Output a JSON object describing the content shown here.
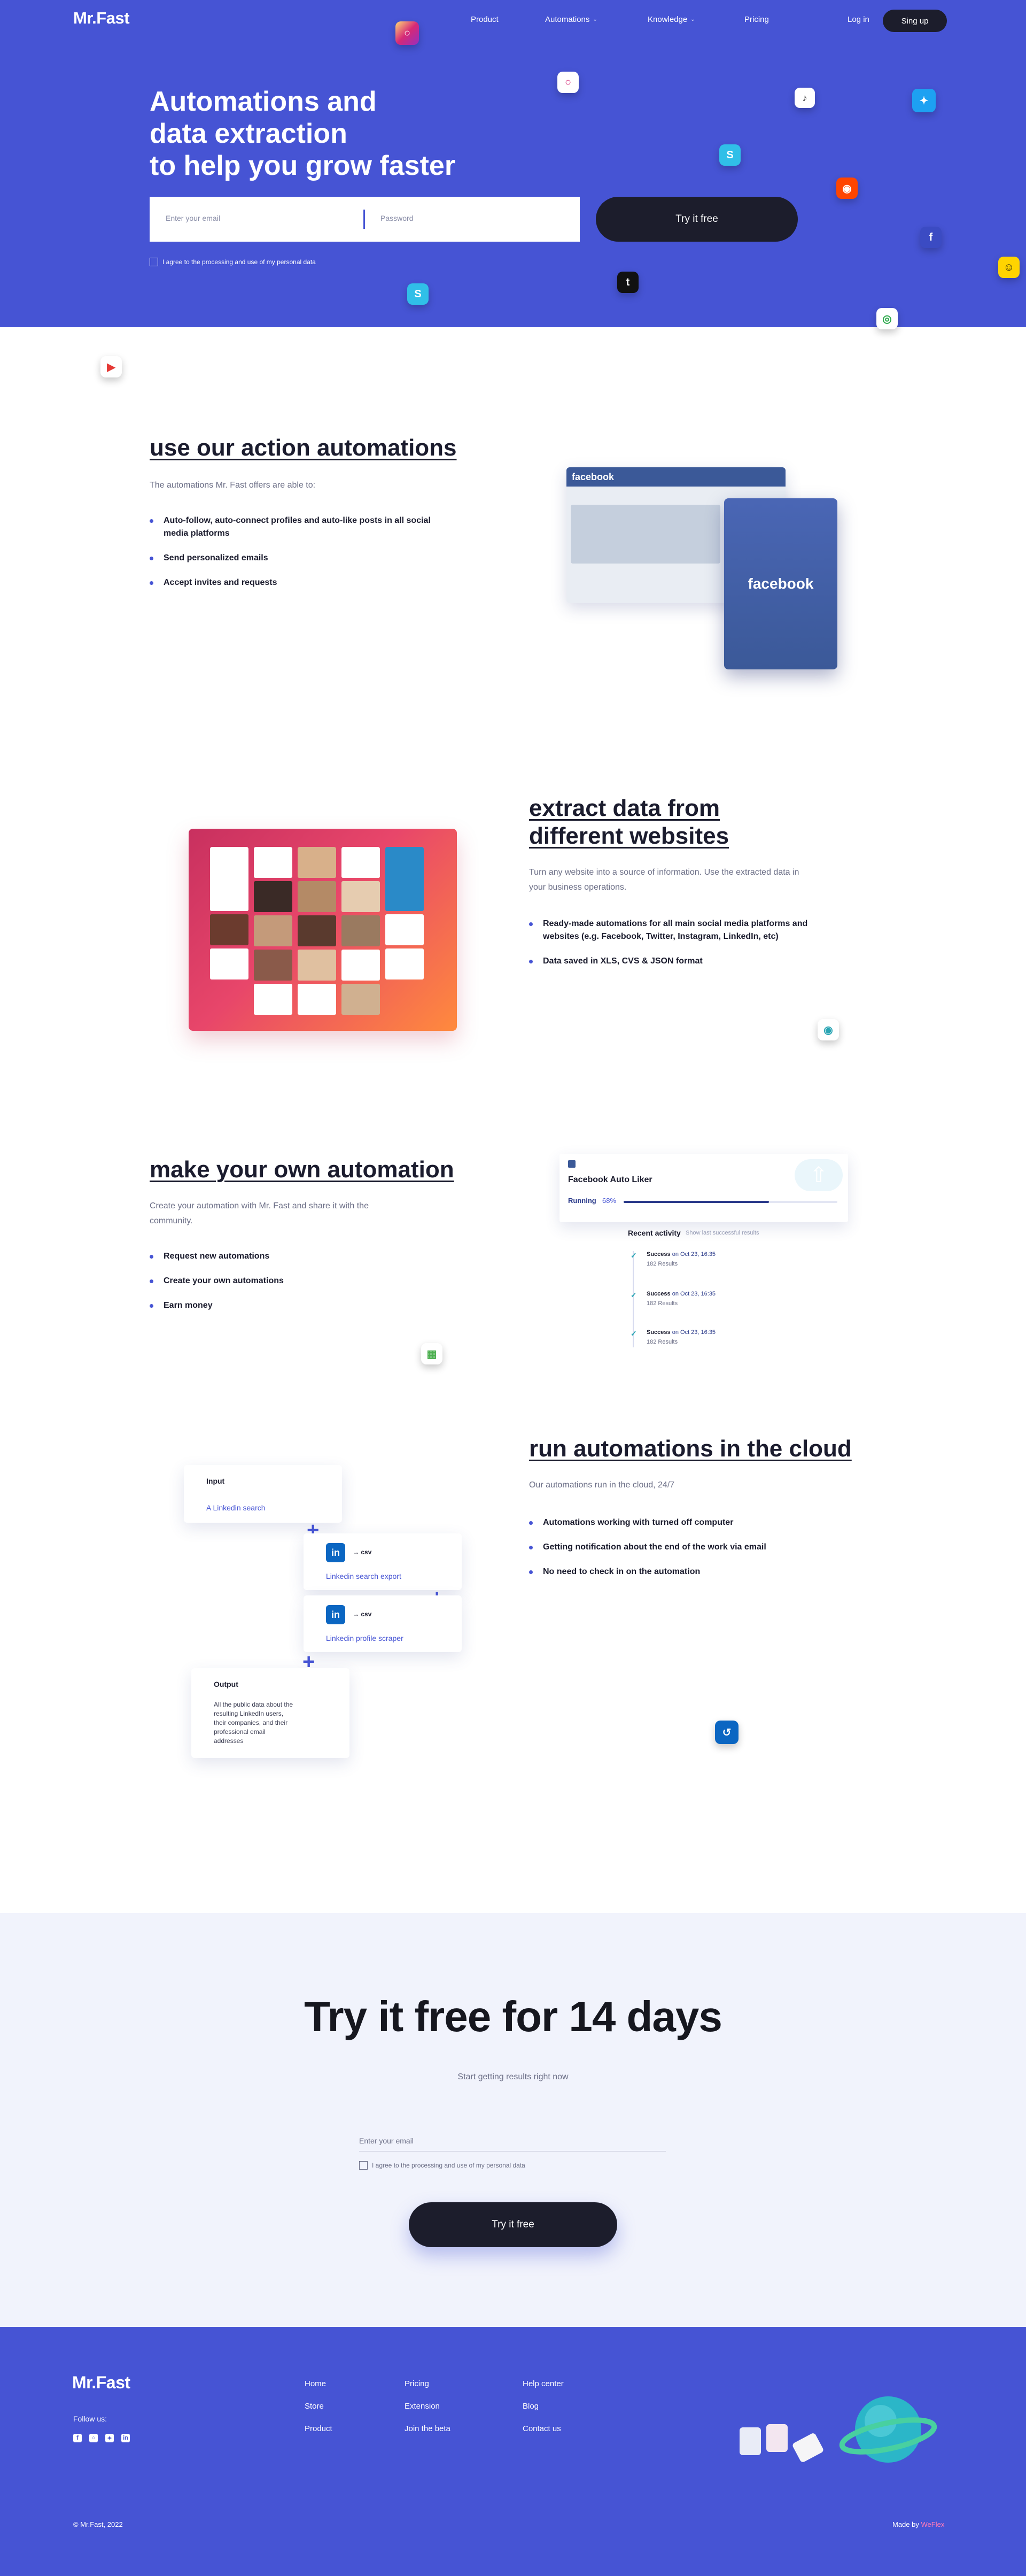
{
  "header": {
    "logo": "Mr.Fast",
    "nav": [
      "Product",
      "Automations",
      "Knowledge",
      "Pricing"
    ],
    "login": "Log in",
    "signup": "Sing up"
  },
  "hero": {
    "title_lines": [
      "Automations and",
      "data extraction",
      "to help you grow faster"
    ],
    "email_placeholder": "Enter your email",
    "password_placeholder": "Password",
    "cta": "Try it free",
    "consent": "I agree to the processing and use of my personal data"
  },
  "sections": {
    "actions": {
      "title": "use our action automations",
      "desc": "The automations Mr. Fast offers are able to:",
      "bullets": [
        "Auto-follow, auto-connect profiles and auto-like posts in all social media platforms",
        "Send personalized emails",
        "Accept invites and requests"
      ],
      "mock_brand": "facebook"
    },
    "extract": {
      "title_lines": [
        "extract data from",
        "different websites"
      ],
      "desc": "Turn any website into a source of information. Use the extracted data in your business operations.",
      "bullets": [
        "Ready-made automations for all main social media platforms and websites (e.g. Facebook, Twitter, Instagram, LinkedIn, etc)",
        "Data saved in XLS, CVS & JSON format"
      ]
    },
    "own": {
      "title": "make your own automation",
      "desc": "Create your automation with Mr. Fast and share it with the community.",
      "bullets": [
        "Request new automations",
        "Create your own automations",
        "Earn money"
      ],
      "card": {
        "name": "Facebook Auto Liker",
        "status": "Running",
        "progress_text": "68%",
        "progress": 0.68,
        "activity_title": "Recent activity",
        "activity_sub": "Show last successful results",
        "items": [
          {
            "status": "Success",
            "time": "on Oct 23, 16:35",
            "results": "182 Results"
          },
          {
            "status": "Success",
            "time": "on Oct 23, 16:35",
            "results": "182 Results"
          },
          {
            "status": "Success",
            "time": "on Oct 23, 16:35",
            "results": "182 Results"
          }
        ]
      }
    },
    "cloud": {
      "title": "run automations in the cloud",
      "desc": "Our automations run in the cloud, 24/7",
      "bullets": [
        "Automations working with turned off computer",
        "Getting notification about the end of the work via email",
        "No need to check in on the automation"
      ],
      "flow": {
        "input_title": "Input",
        "input_link": "A Linkedin search",
        "csv1": "csv",
        "step1": "Linkedin search export",
        "csv2": "csv",
        "step2": "Linkedin profile scraper",
        "output_title": "Output",
        "output_body": "All the public data about the resulting LinkedIn users, their companies, and their professional email addresses"
      }
    }
  },
  "trial": {
    "title": "Try it free for 14 days",
    "subtitle": "Start getting results right now",
    "email_placeholder": "Enter your email",
    "consent": "I agree to the processing and use of my personal data",
    "cta": "Try it free"
  },
  "footer": {
    "logo": "Mr.Fast",
    "follow": "Follow us:",
    "col1": [
      "Home",
      "Store",
      "Product"
    ],
    "col2": [
      "Pricing",
      "Extension",
      "Join the beta"
    ],
    "col3": [
      "Help center",
      "Blog",
      "Contact us"
    ],
    "copyright": "© Mr.Fast, 2022",
    "made_by_prefix": "Made by",
    "made_by": "WeFlex"
  },
  "colors": {
    "brand": "#4654d4",
    "dark": "#1c1d2c",
    "accent_link": "#4654d4"
  }
}
